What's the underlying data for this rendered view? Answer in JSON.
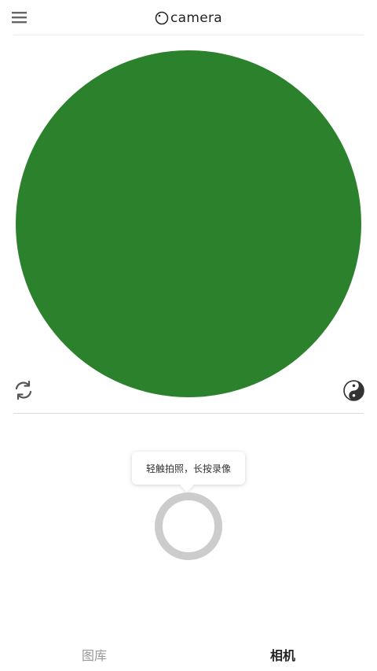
{
  "header": {
    "brand_text": "camera",
    "menu_icon": "hamburger-menu-icon",
    "logo_icon": "camera-lens-logo-icon"
  },
  "viewfinder": {
    "color": "#2c822c"
  },
  "controls": {
    "flip_icon": "camera-flip-icon",
    "filter_icon": "yin-yang-filter-icon"
  },
  "tooltip": {
    "text": "轻触拍照，长按录像"
  },
  "shutter": {
    "ring_color": "#cccccc"
  },
  "bottom_nav": {
    "items": [
      {
        "label": "图库",
        "active": false
      },
      {
        "label": "相机",
        "active": true
      }
    ]
  }
}
